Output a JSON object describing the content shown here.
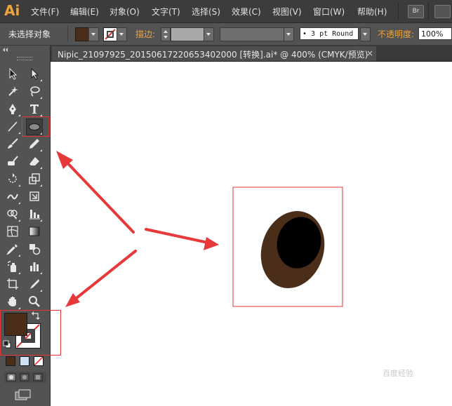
{
  "app": {
    "logo": "Ai",
    "accent": "#f0a33b"
  },
  "menu": {
    "items": [
      "文件(F)",
      "编辑(E)",
      "对象(O)",
      "文字(T)",
      "选择(S)",
      "效果(C)",
      "视图(V)",
      "窗口(W)",
      "帮助(H)"
    ],
    "bridge_label": "Br"
  },
  "control_bar": {
    "selection_status": "未选择对象",
    "fill_color": "#4a2e1a",
    "stroke_label": "描边:",
    "brush_value": "• 3 pt Round",
    "opacity_label": "不透明度:",
    "opacity_value": "100%"
  },
  "document": {
    "tab_title": "Nipic_21097925_20150617220653402000  [转换].ai* @ 400% (CMYK/预览)",
    "close_label": "×",
    "artwork": {
      "outer_color": "#4a2e1a",
      "inner_color": "#000000",
      "frame_color": "#e53333"
    }
  },
  "toolbox": {
    "tools": [
      "selection-tool",
      "direct-selection-tool",
      "magic-wand-tool",
      "lasso-tool",
      "pen-tool",
      "type-tool",
      "line-segment-tool",
      "ellipse-tool",
      "paintbrush-tool",
      "pencil-tool",
      "blob-brush-tool",
      "eraser-tool",
      "rotate-tool",
      "scale-tool",
      "warp-tool",
      "free-transform-tool",
      "shape-builder-tool",
      "graph-tool",
      "mesh-tool",
      "gradient-tool",
      "eyedropper-tool",
      "blend-tool",
      "symbol-sprayer-tool",
      "column-graph-tool",
      "artboard-tool",
      "slice-tool",
      "hand-tool",
      "zoom-tool"
    ],
    "fill_color": "#4a2e1a",
    "highlighted_tool": "ellipse-tool"
  },
  "annotations": {
    "arrow_color": "#e8393a"
  },
  "watermark": {
    "text": "百度经验"
  }
}
